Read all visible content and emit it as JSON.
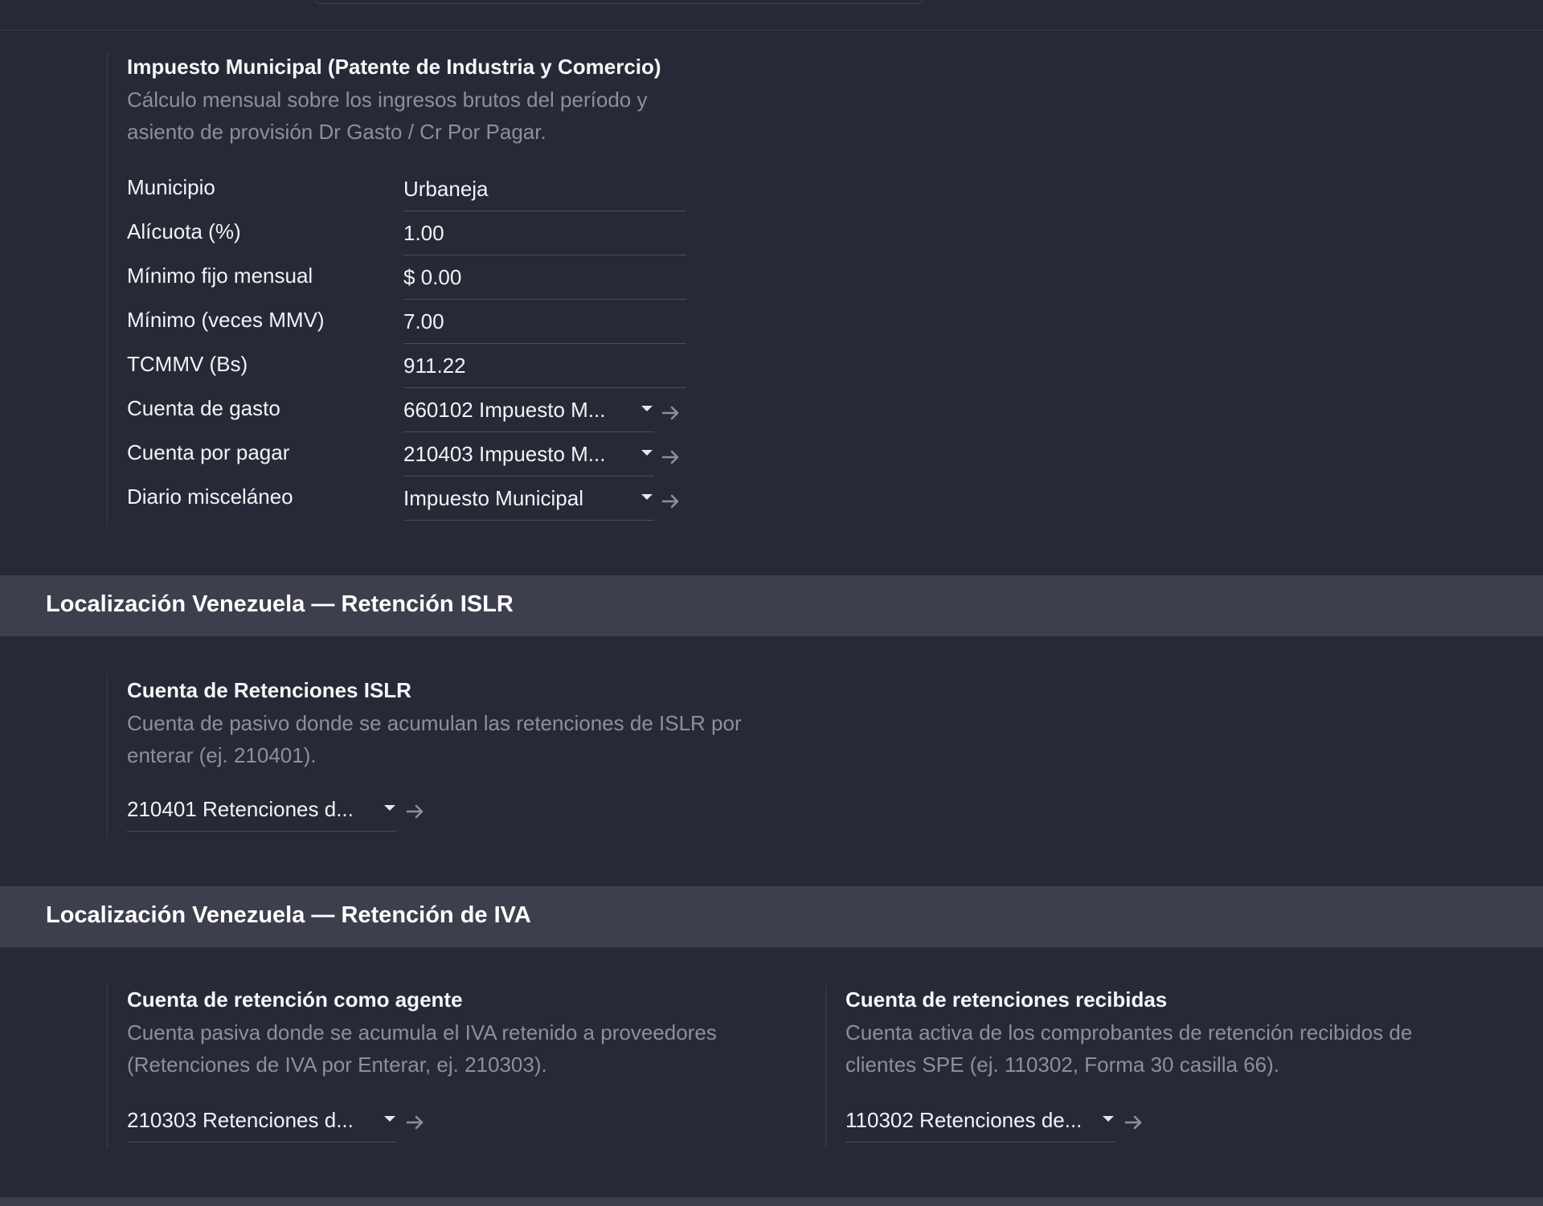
{
  "municipal_tax": {
    "title": "Impuesto Municipal (Patente de Industria y Comercio)",
    "description": "Cálculo mensual sobre los ingresos brutos del período y asiento de provisión Dr Gasto / Cr Por Pagar.",
    "fields": [
      {
        "label": "Municipio",
        "value": "Urbaneja"
      },
      {
        "label": "Alícuota (%)",
        "value": "1.00"
      },
      {
        "label": "Mínimo fijo mensual",
        "value": "$ 0.00"
      },
      {
        "label": "Mínimo (veces MMV)",
        "value": "7.00"
      },
      {
        "label": "TCMMV (Bs)",
        "value": "911.22"
      }
    ],
    "selects": [
      {
        "label": "Cuenta de gasto",
        "value": "660102 Impuesto M..."
      },
      {
        "label": "Cuenta por pagar",
        "value": "210403 Impuesto M..."
      },
      {
        "label": "Diario misceláneo",
        "value": "Impuesto Municipal"
      }
    ]
  },
  "islr_section": {
    "header": "Localización Venezuela — Retención ISLR",
    "account": {
      "title": "Cuenta de Retenciones ISLR",
      "description": "Cuenta de pasivo donde se acumulan las retenciones de ISLR por enterar (ej. 210401).",
      "value": "210401 Retenciones d..."
    }
  },
  "iva_section": {
    "header": "Localización Venezuela — Retención de IVA",
    "agent": {
      "title": "Cuenta de retención como agente",
      "description": "Cuenta pasiva donde se acumula el IVA retenido a proveedores (Retenciones de IVA por Enterar, ej. 210303).",
      "value": "210303 Retenciones d..."
    },
    "received": {
      "title": "Cuenta de retenciones recibidas",
      "description": "Cuenta activa de los comprobantes de retención recibidos de clientes SPE (ej. 110302, Forma 30 casilla 66).",
      "value": "110302 Retenciones de..."
    }
  },
  "icons": {
    "caret": "caret-down-icon",
    "link": "arrow-right-icon"
  },
  "colors": {
    "background": "#262a36",
    "section_header": "#3e3f4c",
    "muted_text": "#8c909b",
    "arrow": "#8b8f99"
  }
}
